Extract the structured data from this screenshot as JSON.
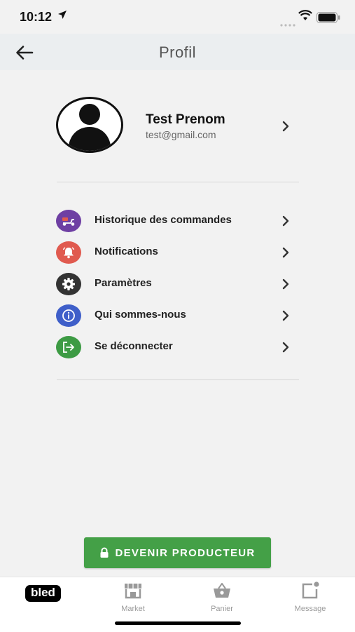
{
  "status_bar": {
    "time": "10:12"
  },
  "header": {
    "title": "Profil",
    "back_icon": "arrow-left-icon"
  },
  "profile": {
    "name": "Test Prenom",
    "email": "test@gmail.com"
  },
  "menu": [
    {
      "label": "Historique des commandes",
      "icon": "scooter-icon",
      "color": "#6e3fa3"
    },
    {
      "label": "Notifications",
      "icon": "bell-icon",
      "color": "#e05a4f"
    },
    {
      "label": "Paramètres",
      "icon": "gear-icon",
      "color": "#333333"
    },
    {
      "label": "Qui sommes-nous",
      "icon": "info-icon",
      "color": "#3f5fc9"
    },
    {
      "label": "Se déconnecter",
      "icon": "logout-icon",
      "color": "#3d9b44"
    }
  ],
  "cta": {
    "label": "DEVENIR PRODUCTEUR",
    "color": "#44a047"
  },
  "tabs": {
    "brand": "bled",
    "market": "Market",
    "panier": "Panier",
    "message": "Message"
  }
}
